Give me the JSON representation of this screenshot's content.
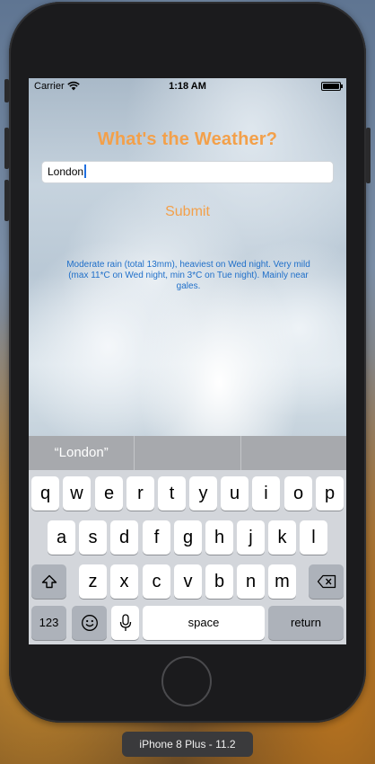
{
  "status_bar": {
    "carrier": "Carrier",
    "time": "1:18 AM"
  },
  "app": {
    "title": "What's the Weather?",
    "city_input_value": "London",
    "submit_label": "Submit",
    "forecast_text": "Moderate rain (total 13mm), heaviest on Wed night. Very mild (max 11*C on Wed night, min 3*C on Tue night). Mainly near gales."
  },
  "predictive_bar": {
    "suggestions": [
      "“London”",
      "",
      ""
    ]
  },
  "keyboard": {
    "row1": [
      "q",
      "w",
      "e",
      "r",
      "t",
      "y",
      "u",
      "i",
      "o",
      "p"
    ],
    "row2": [
      "a",
      "s",
      "d",
      "f",
      "g",
      "h",
      "j",
      "k",
      "l"
    ],
    "row3": [
      "z",
      "x",
      "c",
      "v",
      "b",
      "n",
      "m"
    ],
    "numbers_label": "123",
    "space_label": "space",
    "return_label": "return",
    "icons": [
      "shift-icon",
      "delete-icon",
      "emoji-icon",
      "microphone-icon"
    ]
  },
  "simulator": {
    "device_label": "iPhone 8 Plus - 11.2"
  },
  "colors": {
    "title": "#f3a04a",
    "forecast": "#1f6fc9",
    "accent": "#1f6fe0"
  }
}
